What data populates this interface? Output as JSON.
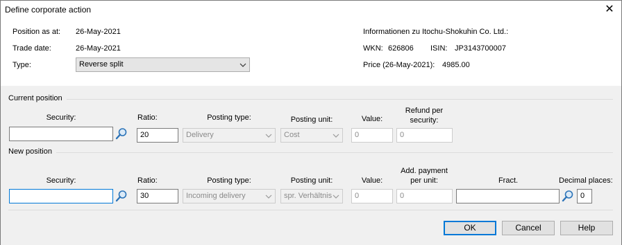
{
  "window": {
    "title": "Define corporate action",
    "close_glyph": "✕"
  },
  "info": {
    "position_as_at_label": "Position as at:",
    "position_as_at_value": "26-May-2021",
    "trade_date_label": "Trade date:",
    "trade_date_value": "26-May-2021",
    "type_label": "Type:",
    "type_value": "Reverse split",
    "company_info": "Informationen zu Itochu-Shokuhin Co. Ltd.:",
    "wkn_label": "WKN:",
    "wkn_value": "626806",
    "isin_label": "ISIN:",
    "isin_value": "JP3143700007",
    "price_label": "Price (26-May-2021):",
    "price_value": "4985.00"
  },
  "current_position": {
    "group_label": "Current position",
    "security_label": "Security:",
    "security_value": "",
    "ratio_label": "Ratio:",
    "ratio_value": "20",
    "posting_type_label": "Posting type:",
    "posting_type_value": "Delivery",
    "posting_unit_label": "Posting unit:",
    "posting_unit_value": "Cost",
    "value_label": "Value:",
    "value_value": "0",
    "refund_label_1": "Refund per",
    "refund_label_2": "security:",
    "refund_value": "0"
  },
  "new_position": {
    "group_label": "New position",
    "security_label": "Security:",
    "security_value": "",
    "ratio_label": "Ratio:",
    "ratio_value": "30",
    "posting_type_label": "Posting type:",
    "posting_type_value": "Incoming delivery",
    "posting_unit_label": "Posting unit:",
    "posting_unit_value": "spr. Verhältnis",
    "value_label": "Value:",
    "value_value": "0",
    "add_payment_label_1": "Add. payment",
    "add_payment_label_2": "per unit:",
    "add_payment_value": "0",
    "fract_label": "Fract.",
    "fract_value": "",
    "decimal_places_label": "Decimal places:",
    "decimal_places_value": "0"
  },
  "buttons": {
    "ok": "OK",
    "cancel": "Cancel",
    "help": "Help"
  },
  "icons": {
    "search": "search-icon",
    "dropdown": "chevron-down-icon",
    "close": "close-icon"
  },
  "colors": {
    "focus_border": "#0078d7",
    "panel_bg": "#f0f0f0"
  }
}
